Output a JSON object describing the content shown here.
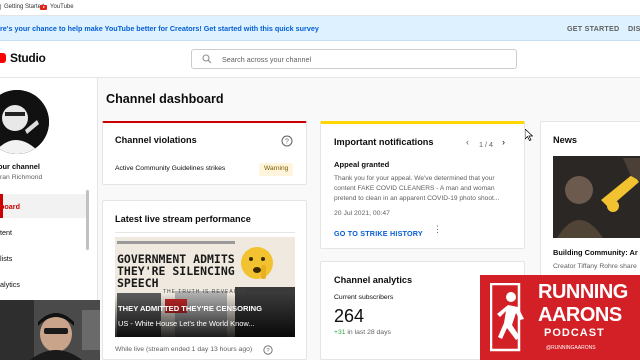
{
  "colors": {
    "accent_red": "#cc0000",
    "link_blue": "#065fd4",
    "warning_yellow": "#ffd600",
    "positive_green": "#2ba640",
    "podcast_red": "#d32027"
  },
  "bookmarks": [
    {
      "label": "Getting Started",
      "icon": "bookmark-icon"
    },
    {
      "label": "YouTube",
      "icon": "youtube-icon"
    }
  ],
  "banner": {
    "text": "re's your chance to help make YouTube better for Creators! Get started with this quick survey",
    "get_started": "GET STARTED",
    "dismiss": "DIS"
  },
  "header": {
    "logo_text": "Studio",
    "search_placeholder": "Search across your channel"
  },
  "sidebar": {
    "your_channel": "our channel",
    "channel_name": "ran Richmond",
    "items": [
      {
        "label": "board",
        "active": true
      },
      {
        "label": "tent",
        "active": false
      },
      {
        "label": "lists",
        "active": false
      },
      {
        "label": "alytics",
        "active": false
      }
    ]
  },
  "main": {
    "page_title": "Channel dashboard",
    "violations": {
      "title": "Channel violations",
      "row_label": "Active Community Guidelines strikes",
      "badge": "Warning"
    },
    "livestream": {
      "title": "Latest live stream performance",
      "thumb_headline": "GOVERNMENT ADMITS THEY'RE SILENCING SPEECH",
      "thumb_sub": "THE TRUTH IS REVEALED",
      "video_title_line1": "THEY ADMITTED THEY'RE CENSORING",
      "video_title_line2": "US - White House Let's the World Know...",
      "meta": "While live (stream ended 1 day 13 hours ago)"
    },
    "notifications": {
      "title": "Important notifications",
      "pager": "1 / 4",
      "heading": "Appeal granted",
      "body": "Thank you for your appeal. We've determined that your content FAKE COVID CLEANERS - A man and woman pretend to clean in an apparent COVID-19 photo shoot...",
      "date": "20 Jul 2021, 00:47",
      "link": "GO TO STRIKE HISTORY"
    },
    "analytics": {
      "title": "Channel analytics",
      "subs_label": "Current subscribers",
      "subs_value": "264",
      "subs_delta_value": "+31",
      "subs_delta_period": "in last 28 days"
    },
    "news": {
      "title": "News",
      "headline": "Building Community: Ar",
      "byline": "Creator Tiffany Rohre share"
    }
  },
  "overlay_logo": {
    "line1": "RUNNING",
    "line2": "AARONS",
    "line3": "PODCAST",
    "handle": "@RUNNINGAARONS"
  }
}
